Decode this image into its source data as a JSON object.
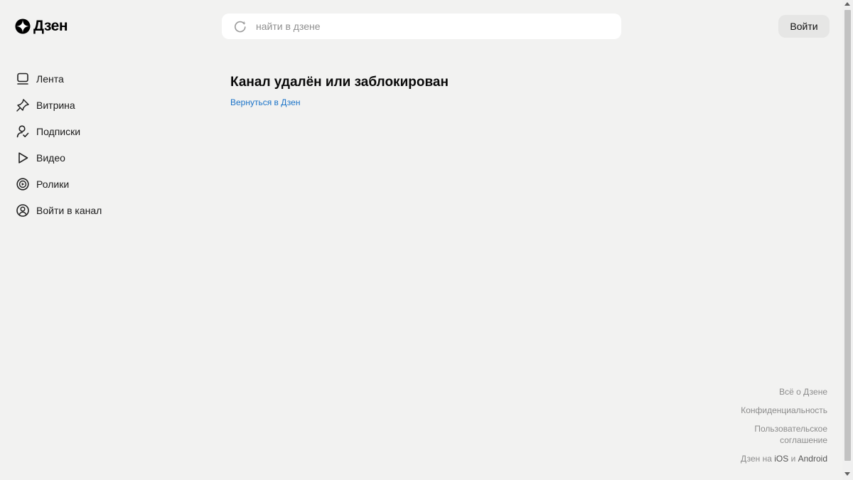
{
  "header": {
    "logo_text": "Дзен",
    "search_placeholder": "найти в дзене",
    "login_label": "Войти"
  },
  "sidebar": {
    "items": [
      {
        "label": "Лента",
        "icon": "feed-icon"
      },
      {
        "label": "Витрина",
        "icon": "showcase-icon"
      },
      {
        "label": "Подписки",
        "icon": "subscriptions-icon"
      },
      {
        "label": "Видео",
        "icon": "play-icon"
      },
      {
        "label": "Ролики",
        "icon": "shorts-icon"
      },
      {
        "label": "Войти в канал",
        "icon": "profile-icon"
      }
    ]
  },
  "main": {
    "title": "Канал удалён или заблокирован",
    "back_link": "Вернуться в Дзен"
  },
  "footer": {
    "about": "Всё о Дзене",
    "privacy": "Конфиденциальность",
    "terms": "Пользовательское соглашение",
    "apps_prefix": "Дзен на",
    "ios": "iOS",
    "and": "и",
    "android": "Android"
  },
  "colors": {
    "background": "#f2f2f1",
    "link": "#1a73c8",
    "footer_text": "#8c8c8c"
  }
}
